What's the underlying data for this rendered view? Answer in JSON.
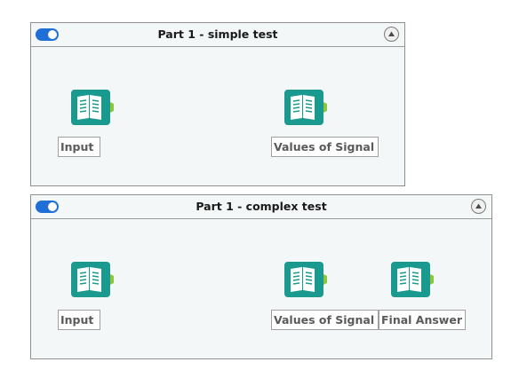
{
  "containers": [
    {
      "title": "Part 1 - simple test",
      "enabled": true,
      "tools": [
        {
          "label": "Input",
          "icon": "book-icon"
        },
        {
          "label": "Values of Signal",
          "icon": "book-icon"
        }
      ]
    },
    {
      "title": "Part 1 - complex test",
      "enabled": true,
      "tools": [
        {
          "label": "Input",
          "icon": "book-icon"
        },
        {
          "label": "Values of Signal",
          "icon": "book-icon"
        },
        {
          "label": "Final Answer",
          "icon": "book-icon"
        }
      ]
    }
  ],
  "colors": {
    "tool_teal": "#1a9a8f",
    "anchor_green": "#8cc63f",
    "toggle_blue": "#1f6fd6"
  }
}
